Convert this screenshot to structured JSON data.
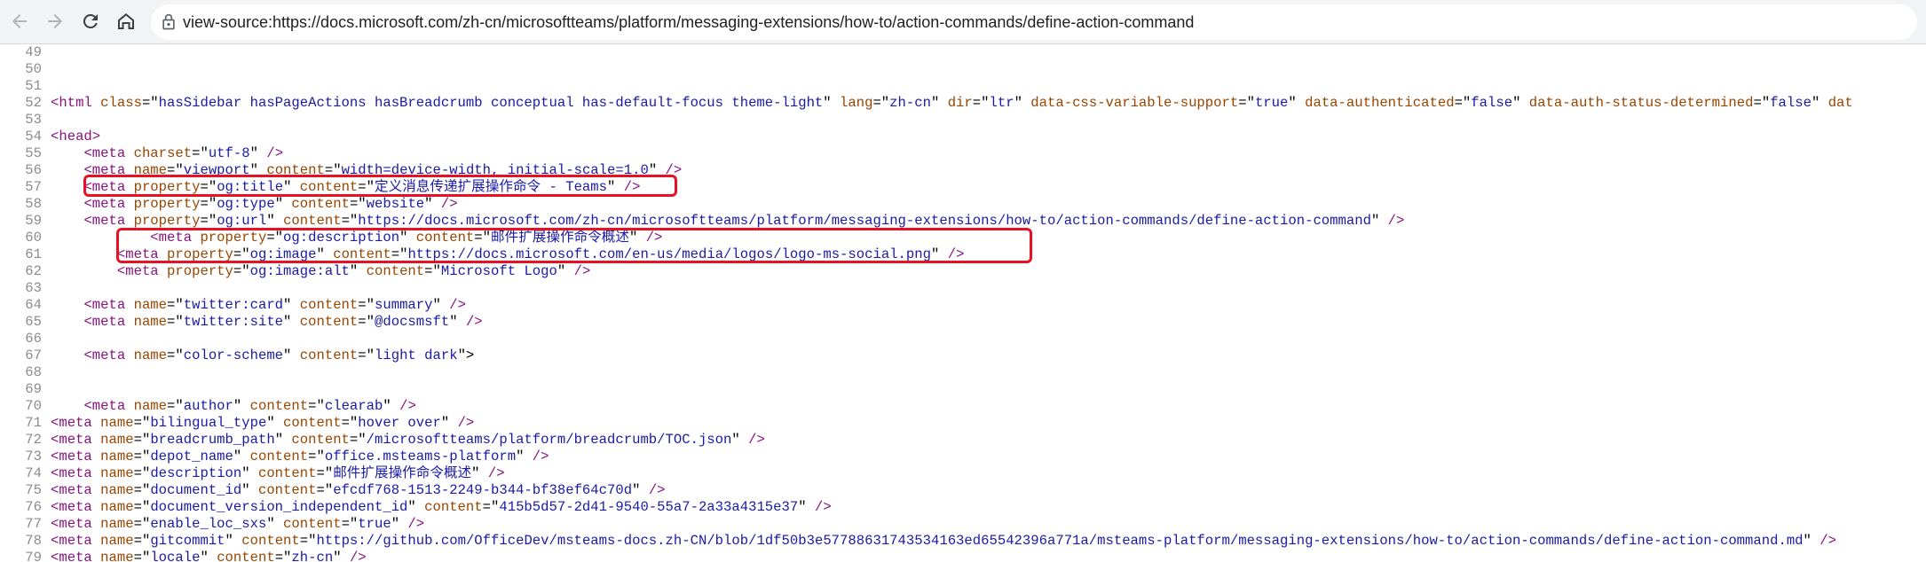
{
  "browser": {
    "url_text": "view-source:https://docs.microsoft.com/zh-cn/microsoftteams/platform/messaging-extensions/how-to/action-commands/define-action-command",
    "back_icon": "arrow-left-icon",
    "forward_icon": "arrow-right-icon",
    "reload_icon": "reload-icon",
    "home_icon": "home-icon",
    "lock_icon": "lock-icon"
  },
  "source_lines": [
    {
      "num": "49",
      "tokens": []
    },
    {
      "num": "50",
      "tokens": []
    },
    {
      "num": "51",
      "tokens": []
    },
    {
      "num": "52",
      "tokens": [
        [
          "t",
          "<html "
        ],
        [
          "a",
          "class"
        ],
        [
          "",
          "=\""
        ],
        [
          "v",
          "hasSidebar hasPageActions hasBreadcrumb conceptual has-default-focus theme-light"
        ],
        [
          "",
          "\" "
        ],
        [
          "a",
          "lang"
        ],
        [
          "",
          "=\""
        ],
        [
          "v",
          "zh-cn"
        ],
        [
          "",
          "\" "
        ],
        [
          "a",
          "dir"
        ],
        [
          "",
          "=\""
        ],
        [
          "v",
          "ltr"
        ],
        [
          "",
          "\" "
        ],
        [
          "a",
          "data-css-variable-support"
        ],
        [
          "",
          "=\""
        ],
        [
          "v",
          "true"
        ],
        [
          "",
          "\" "
        ],
        [
          "a",
          "data-authenticated"
        ],
        [
          "",
          "=\""
        ],
        [
          "v",
          "false"
        ],
        [
          "",
          "\" "
        ],
        [
          "a",
          "data-auth-status-determined"
        ],
        [
          "",
          "=\""
        ],
        [
          "v",
          "false"
        ],
        [
          "",
          "\" "
        ],
        [
          "a",
          "dat"
        ]
      ]
    },
    {
      "num": "53",
      "tokens": []
    },
    {
      "num": "54",
      "tokens": [
        [
          "t",
          "<head>"
        ]
      ]
    },
    {
      "num": "55",
      "tokens": [
        [
          "",
          "    "
        ],
        [
          "t",
          "<meta "
        ],
        [
          "a",
          "charset"
        ],
        [
          "",
          "=\""
        ],
        [
          "v",
          "utf-8"
        ],
        [
          "",
          "\" "
        ],
        [
          "t",
          "/>"
        ]
      ]
    },
    {
      "num": "56",
      "tokens": [
        [
          "",
          "    "
        ],
        [
          "t",
          "<meta "
        ],
        [
          "a",
          "name"
        ],
        [
          "",
          "=\""
        ],
        [
          "v",
          "viewport"
        ],
        [
          "",
          "\" "
        ],
        [
          "a",
          "content"
        ],
        [
          "",
          "=\""
        ],
        [
          "v",
          "width=device-width, initial-scale=1.0"
        ],
        [
          "",
          "\" "
        ],
        [
          "t",
          "/>"
        ]
      ]
    },
    {
      "num": "57",
      "tokens": [
        [
          "",
          "    "
        ],
        [
          "t",
          "<meta "
        ],
        [
          "a",
          "property"
        ],
        [
          "",
          "=\""
        ],
        [
          "v",
          "og:title"
        ],
        [
          "",
          "\" "
        ],
        [
          "a",
          "content"
        ],
        [
          "",
          "=\""
        ],
        [
          "v",
          "定义消息传递扩展操作命令 - Teams"
        ],
        [
          "",
          "\" "
        ],
        [
          "t",
          "/>"
        ]
      ]
    },
    {
      "num": "58",
      "tokens": [
        [
          "",
          "    "
        ],
        [
          "t",
          "<meta "
        ],
        [
          "a",
          "property"
        ],
        [
          "",
          "=\""
        ],
        [
          "v",
          "og:type"
        ],
        [
          "",
          "\" "
        ],
        [
          "a",
          "content"
        ],
        [
          "",
          "=\""
        ],
        [
          "v",
          "website"
        ],
        [
          "",
          "\" "
        ],
        [
          "t",
          "/>"
        ]
      ]
    },
    {
      "num": "59",
      "tokens": [
        [
          "",
          "    "
        ],
        [
          "t",
          "<meta "
        ],
        [
          "a",
          "property"
        ],
        [
          "",
          "=\""
        ],
        [
          "v",
          "og:url"
        ],
        [
          "",
          "\" "
        ],
        [
          "a",
          "content"
        ],
        [
          "",
          "=\""
        ],
        [
          "v",
          "https://docs.microsoft.com/zh-cn/microsoftteams/platform/messaging-extensions/how-to/action-commands/define-action-command"
        ],
        [
          "",
          "\" "
        ],
        [
          "t",
          "/>"
        ]
      ]
    },
    {
      "num": "60",
      "tokens": [
        [
          "",
          "            "
        ],
        [
          "t",
          "<meta "
        ],
        [
          "a",
          "property"
        ],
        [
          "",
          "=\""
        ],
        [
          "v",
          "og:description"
        ],
        [
          "",
          "\" "
        ],
        [
          "a",
          "content"
        ],
        [
          "",
          "=\""
        ],
        [
          "v",
          "邮件扩展操作命令概述"
        ],
        [
          "",
          "\" "
        ],
        [
          "t",
          "/>"
        ]
      ]
    },
    {
      "num": "61",
      "tokens": [
        [
          "",
          "        "
        ],
        [
          "t",
          "<meta "
        ],
        [
          "a",
          "property"
        ],
        [
          "",
          "=\""
        ],
        [
          "v",
          "og:image"
        ],
        [
          "",
          "\" "
        ],
        [
          "a",
          "content"
        ],
        [
          "",
          "=\""
        ],
        [
          "v",
          "https://docs.microsoft.com/en-us/media/logos/logo-ms-social.png"
        ],
        [
          "",
          "\" "
        ],
        [
          "t",
          "/>"
        ]
      ]
    },
    {
      "num": "62",
      "tokens": [
        [
          "",
          "        "
        ],
        [
          "t",
          "<meta "
        ],
        [
          "a",
          "property"
        ],
        [
          "",
          "=\""
        ],
        [
          "v",
          "og:image:alt"
        ],
        [
          "",
          "\" "
        ],
        [
          "a",
          "content"
        ],
        [
          "",
          "=\""
        ],
        [
          "v",
          "Microsoft Logo"
        ],
        [
          "",
          "\" "
        ],
        [
          "t",
          "/>"
        ]
      ]
    },
    {
      "num": "63",
      "tokens": []
    },
    {
      "num": "64",
      "tokens": [
        [
          "",
          "    "
        ],
        [
          "t",
          "<meta "
        ],
        [
          "a",
          "name"
        ],
        [
          "",
          "=\""
        ],
        [
          "v",
          "twitter:card"
        ],
        [
          "",
          "\" "
        ],
        [
          "a",
          "content"
        ],
        [
          "",
          "=\""
        ],
        [
          "v",
          "summary"
        ],
        [
          "",
          "\" "
        ],
        [
          "t",
          "/>"
        ]
      ]
    },
    {
      "num": "65",
      "tokens": [
        [
          "",
          "    "
        ],
        [
          "t",
          "<meta "
        ],
        [
          "a",
          "name"
        ],
        [
          "",
          "=\""
        ],
        [
          "v",
          "twitter:site"
        ],
        [
          "",
          "\" "
        ],
        [
          "a",
          "content"
        ],
        [
          "",
          "=\""
        ],
        [
          "v",
          "@docsmsft"
        ],
        [
          "",
          "\" "
        ],
        [
          "t",
          "/>"
        ]
      ]
    },
    {
      "num": "66",
      "tokens": []
    },
    {
      "num": "67",
      "tokens": [
        [
          "",
          "    "
        ],
        [
          "t",
          "<meta "
        ],
        [
          "a",
          "name"
        ],
        [
          "",
          "=\""
        ],
        [
          "v",
          "color-scheme"
        ],
        [
          "",
          "\" "
        ],
        [
          "a",
          "content"
        ],
        [
          "",
          "=\""
        ],
        [
          "v",
          "light dark"
        ],
        [
          "",
          "\">"
        ]
      ]
    },
    {
      "num": "68",
      "tokens": []
    },
    {
      "num": "69",
      "tokens": []
    },
    {
      "num": "70",
      "tokens": [
        [
          "",
          "    "
        ],
        [
          "t",
          "<meta "
        ],
        [
          "a",
          "name"
        ],
        [
          "",
          "=\""
        ],
        [
          "v",
          "author"
        ],
        [
          "",
          "\" "
        ],
        [
          "a",
          "content"
        ],
        [
          "",
          "=\""
        ],
        [
          "v",
          "clearab"
        ],
        [
          "",
          "\" "
        ],
        [
          "t",
          "/>"
        ]
      ]
    },
    {
      "num": "71",
      "tokens": [
        [
          "t",
          "<meta "
        ],
        [
          "a",
          "name"
        ],
        [
          "",
          "=\""
        ],
        [
          "v",
          "bilingual_type"
        ],
        [
          "",
          "\" "
        ],
        [
          "a",
          "content"
        ],
        [
          "",
          "=\""
        ],
        [
          "v",
          "hover over"
        ],
        [
          "",
          "\" "
        ],
        [
          "t",
          "/>"
        ]
      ]
    },
    {
      "num": "72",
      "tokens": [
        [
          "t",
          "<meta "
        ],
        [
          "a",
          "name"
        ],
        [
          "",
          "=\""
        ],
        [
          "v",
          "breadcrumb_path"
        ],
        [
          "",
          "\" "
        ],
        [
          "a",
          "content"
        ],
        [
          "",
          "=\""
        ],
        [
          "v",
          "/microsoftteams/platform/breadcrumb/TOC.json"
        ],
        [
          "",
          "\" "
        ],
        [
          "t",
          "/>"
        ]
      ]
    },
    {
      "num": "73",
      "tokens": [
        [
          "t",
          "<meta "
        ],
        [
          "a",
          "name"
        ],
        [
          "",
          "=\""
        ],
        [
          "v",
          "depot_name"
        ],
        [
          "",
          "\" "
        ],
        [
          "a",
          "content"
        ],
        [
          "",
          "=\""
        ],
        [
          "v",
          "office.msteams-platform"
        ],
        [
          "",
          "\" "
        ],
        [
          "t",
          "/>"
        ]
      ]
    },
    {
      "num": "74",
      "tokens": [
        [
          "t",
          "<meta "
        ],
        [
          "a",
          "name"
        ],
        [
          "",
          "=\""
        ],
        [
          "v",
          "description"
        ],
        [
          "",
          "\" "
        ],
        [
          "a",
          "content"
        ],
        [
          "",
          "=\""
        ],
        [
          "v",
          "邮件扩展操作命令概述"
        ],
        [
          "",
          "\" "
        ],
        [
          "t",
          "/>"
        ]
      ]
    },
    {
      "num": "75",
      "tokens": [
        [
          "t",
          "<meta "
        ],
        [
          "a",
          "name"
        ],
        [
          "",
          "=\""
        ],
        [
          "v",
          "document_id"
        ],
        [
          "",
          "\" "
        ],
        [
          "a",
          "content"
        ],
        [
          "",
          "=\""
        ],
        [
          "v",
          "efcdf768-1513-2249-b344-bf38ef64c70d"
        ],
        [
          "",
          "\" "
        ],
        [
          "t",
          "/>"
        ]
      ]
    },
    {
      "num": "76",
      "tokens": [
        [
          "t",
          "<meta "
        ],
        [
          "a",
          "name"
        ],
        [
          "",
          "=\""
        ],
        [
          "v",
          "document_version_independent_id"
        ],
        [
          "",
          "\" "
        ],
        [
          "a",
          "content"
        ],
        [
          "",
          "=\""
        ],
        [
          "v",
          "415b5d57-2d41-9540-55a7-2a33a4315e37"
        ],
        [
          "",
          "\" "
        ],
        [
          "t",
          "/>"
        ]
      ]
    },
    {
      "num": "77",
      "tokens": [
        [
          "t",
          "<meta "
        ],
        [
          "a",
          "name"
        ],
        [
          "",
          "=\""
        ],
        [
          "v",
          "enable_loc_sxs"
        ],
        [
          "",
          "\" "
        ],
        [
          "a",
          "content"
        ],
        [
          "",
          "=\""
        ],
        [
          "v",
          "true"
        ],
        [
          "",
          "\" "
        ],
        [
          "t",
          "/>"
        ]
      ]
    },
    {
      "num": "78",
      "tokens": [
        [
          "t",
          "<meta "
        ],
        [
          "a",
          "name"
        ],
        [
          "",
          "=\""
        ],
        [
          "v",
          "gitcommit"
        ],
        [
          "",
          "\" "
        ],
        [
          "a",
          "content"
        ],
        [
          "",
          "=\""
        ],
        [
          "v",
          "https://github.com/OfficeDev/msteams-docs.zh-CN/blob/1df50b3e57788631743534163ed65542396a771a/msteams-platform/messaging-extensions/how-to/action-commands/define-action-command.md"
        ],
        [
          "",
          "\" "
        ],
        [
          "t",
          "/>"
        ]
      ]
    },
    {
      "num": "79",
      "tokens": [
        [
          "t",
          "<meta "
        ],
        [
          "a",
          "name"
        ],
        [
          "",
          "=\""
        ],
        [
          "v",
          "locale"
        ],
        [
          "",
          "\" "
        ],
        [
          "a",
          "content"
        ],
        [
          "",
          "=\""
        ],
        [
          "v",
          "zh-cn"
        ],
        [
          "",
          "\" "
        ],
        [
          "t",
          "/>"
        ]
      ]
    }
  ],
  "colors": {
    "tag": "#881280",
    "attribute": "#994500",
    "value": "#1a1aa6",
    "line_number": "#8c8c8c",
    "highlight_box": "#e81123"
  }
}
